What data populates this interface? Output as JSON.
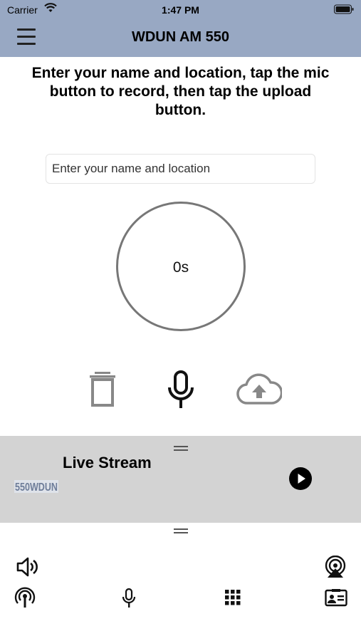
{
  "status_bar": {
    "carrier": "Carrier",
    "time": "1:47 PM"
  },
  "header": {
    "title": "WDUN AM 550"
  },
  "instructions": "Enter your name and location, tap the mic button to record, then tap the upload button.",
  "name_input": {
    "placeholder": "Enter your name and location",
    "value": ""
  },
  "timer": {
    "value": "0s"
  },
  "controls": {
    "delete": "trash-icon",
    "record": "microphone-icon",
    "upload": "cloud-upload-icon"
  },
  "player": {
    "title": "Live Stream",
    "logo_text": "550WDUN",
    "state": "paused"
  },
  "tab_bar": [
    {
      "icon": "speaker-icon"
    },
    {
      "icon": "airplay-icon"
    },
    {
      "icon": "podcast-icon"
    },
    {
      "icon": "microphone-icon"
    },
    {
      "icon": "grid-icon"
    },
    {
      "icon": "contact-card-icon"
    }
  ],
  "colors": {
    "header_bg": "#98a8c3",
    "player_bg": "#d3d3d3",
    "circle": "#777777"
  }
}
